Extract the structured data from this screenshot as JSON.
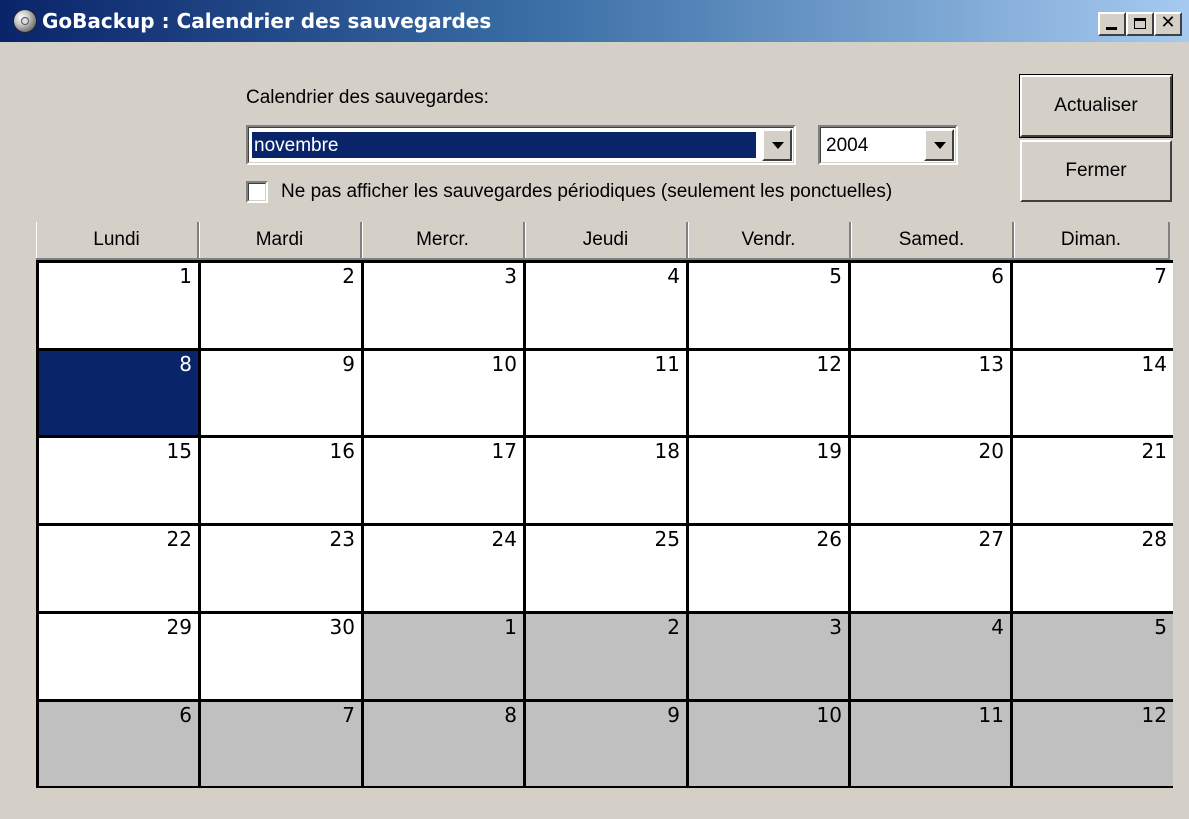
{
  "window": {
    "title": "GoBackup : Calendrier des sauvegardes"
  },
  "form": {
    "label": "Calendrier des sauvegardes:",
    "month": "novembre",
    "year": "2004",
    "checkbox_label": "Ne pas afficher les sauvegardes périodiques (seulement les ponctuelles)",
    "checkbox_checked": false
  },
  "buttons": {
    "refresh": "Actualiser",
    "close": "Fermer"
  },
  "calendar": {
    "weekdays": [
      "Lundi",
      "Mardi",
      "Mercr.",
      "Jeudi",
      "Vendr.",
      "Samed.",
      "Diman."
    ],
    "selected_day": 8,
    "weeks": [
      [
        {
          "day": "1",
          "current": true
        },
        {
          "day": "2",
          "current": true
        },
        {
          "day": "3",
          "current": true
        },
        {
          "day": "4",
          "current": true
        },
        {
          "day": "5",
          "current": true
        },
        {
          "day": "6",
          "current": true
        },
        {
          "day": "7",
          "current": true
        }
      ],
      [
        {
          "day": "8",
          "current": true,
          "selected": true
        },
        {
          "day": "9",
          "current": true
        },
        {
          "day": "10",
          "current": true
        },
        {
          "day": "11",
          "current": true
        },
        {
          "day": "12",
          "current": true
        },
        {
          "day": "13",
          "current": true
        },
        {
          "day": "14",
          "current": true
        }
      ],
      [
        {
          "day": "15",
          "current": true
        },
        {
          "day": "16",
          "current": true
        },
        {
          "day": "17",
          "current": true
        },
        {
          "day": "18",
          "current": true
        },
        {
          "day": "19",
          "current": true
        },
        {
          "day": "20",
          "current": true
        },
        {
          "day": "21",
          "current": true
        }
      ],
      [
        {
          "day": "22",
          "current": true
        },
        {
          "day": "23",
          "current": true
        },
        {
          "day": "24",
          "current": true
        },
        {
          "day": "25",
          "current": true
        },
        {
          "day": "26",
          "current": true
        },
        {
          "day": "27",
          "current": true
        },
        {
          "day": "28",
          "current": true
        }
      ],
      [
        {
          "day": "29",
          "current": true
        },
        {
          "day": "30",
          "current": true
        },
        {
          "day": "1",
          "current": false
        },
        {
          "day": "2",
          "current": false
        },
        {
          "day": "3",
          "current": false
        },
        {
          "day": "4",
          "current": false
        },
        {
          "day": "5",
          "current": false
        }
      ],
      [
        {
          "day": "6",
          "current": false
        },
        {
          "day": "7",
          "current": false
        },
        {
          "day": "8",
          "current": false
        },
        {
          "day": "9",
          "current": false
        },
        {
          "day": "10",
          "current": false
        },
        {
          "day": "11",
          "current": false
        },
        {
          "day": "12",
          "current": false
        }
      ]
    ]
  },
  "colors": {
    "selection": "#0a246a",
    "other_month": "#c0c0c0",
    "window_bg": "#d4d0c8"
  }
}
